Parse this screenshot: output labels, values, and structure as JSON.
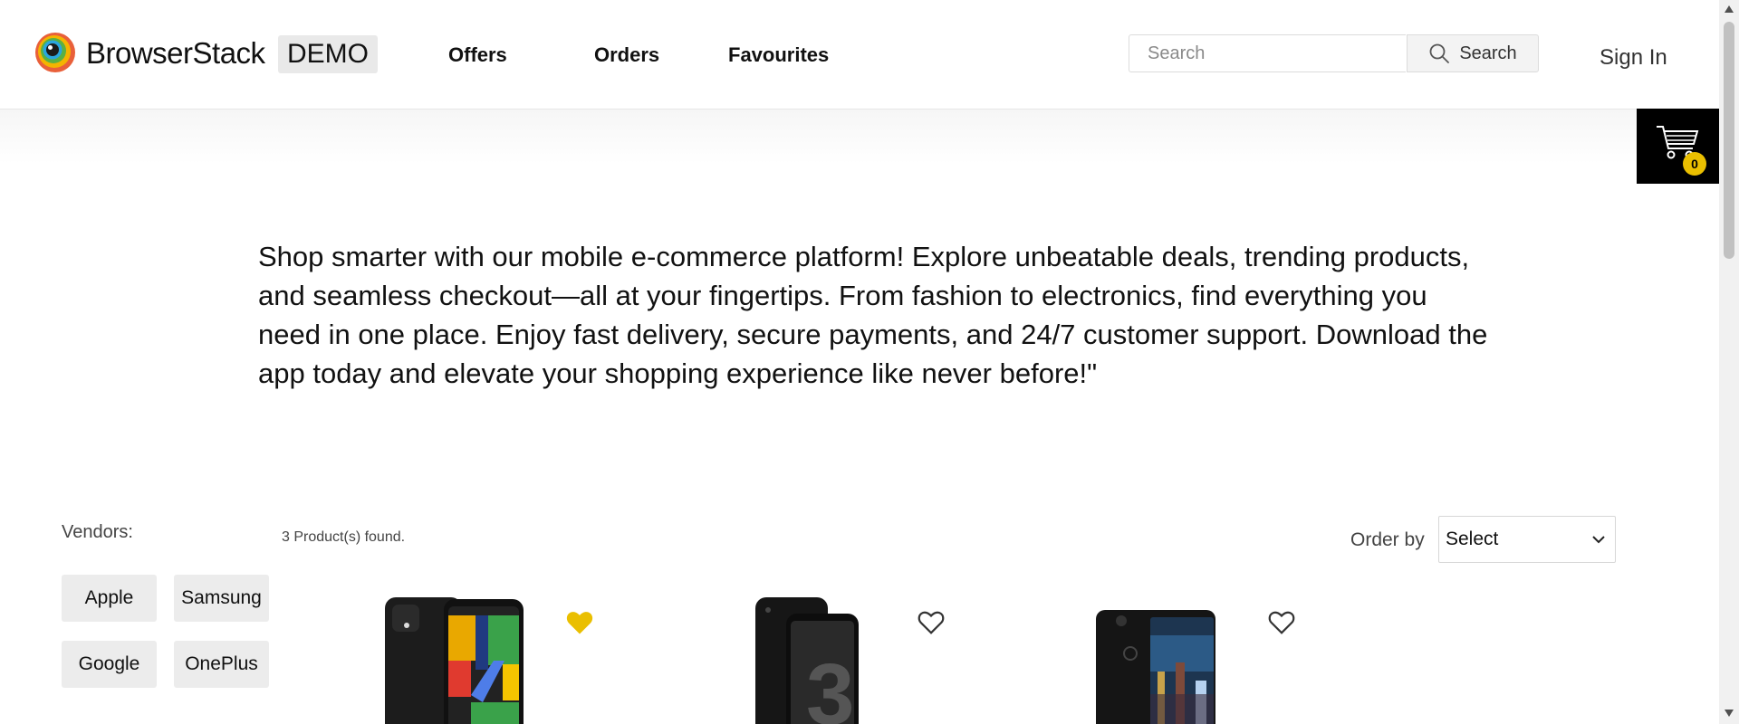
{
  "header": {
    "brand": "BrowserStack",
    "badge": "DEMO",
    "nav": [
      "Offers",
      "Orders",
      "Favourites"
    ],
    "search_placeholder": "Search",
    "search_button": "Search",
    "sign_in": "Sign In"
  },
  "cart": {
    "count": "0"
  },
  "banner": {
    "text": "Shop smarter with our mobile e-commerce platform! Explore unbeatable deals, trending products, and seamless checkout—all at your fingertips. From fashion to electronics, find everything you need in one place. Enjoy fast delivery, secure payments, and 24/7 customer support. Download the app today and elevate your shopping experience like never before!\""
  },
  "filters": {
    "label": "Vendors:",
    "vendors": [
      "Apple",
      "Samsung",
      "Google",
      "OnePlus"
    ]
  },
  "results": {
    "count_text": "3 Product(s) found.",
    "order_label": "Order by",
    "order_selected": "Select"
  },
  "products": [
    {
      "icon": "pixel-4-phone-image",
      "favourited": true
    },
    {
      "icon": "pixel-3-phone-image",
      "favourited": false
    },
    {
      "icon": "pixel-2-phone-image",
      "favourited": false
    }
  ],
  "colors": {
    "accent": "#eabf00",
    "cart_bg": "#000000",
    "badge_bg": "#e9e9e9"
  }
}
